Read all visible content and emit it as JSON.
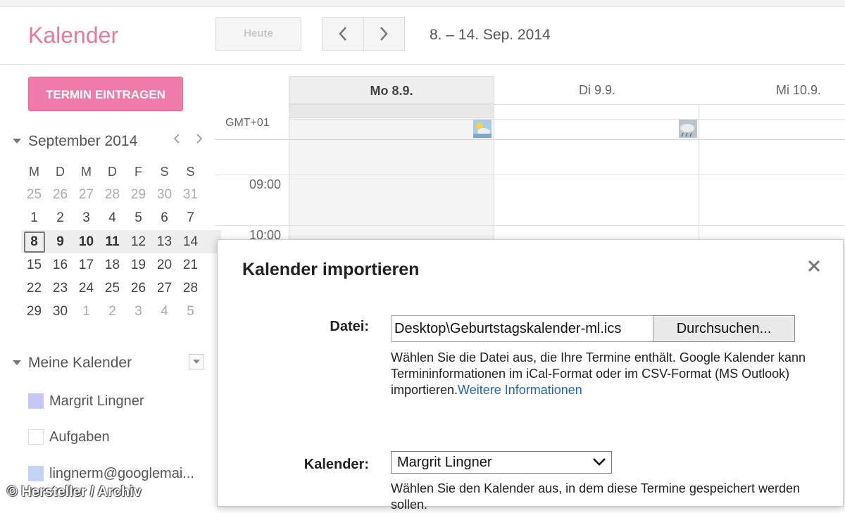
{
  "header": {
    "app_title": "Kalender",
    "today_label": "Heute",
    "date_range": "8. – 14. Sep. 2014"
  },
  "sidebar": {
    "create_label": "TERMIN EINTRAGEN",
    "mini_calendar": {
      "title": "September 2014",
      "weekdays": [
        "M",
        "D",
        "M",
        "D",
        "F",
        "S",
        "S"
      ],
      "weeks": [
        [
          "25",
          "26",
          "27",
          "28",
          "29",
          "30",
          "31"
        ],
        [
          "1",
          "2",
          "3",
          "4",
          "5",
          "6",
          "7"
        ],
        [
          "8",
          "9",
          "10",
          "11",
          "12",
          "13",
          "14"
        ],
        [
          "15",
          "16",
          "17",
          "18",
          "19",
          "20",
          "21"
        ],
        [
          "22",
          "23",
          "24",
          "25",
          "26",
          "27",
          "28"
        ],
        [
          "29",
          "30",
          "1",
          "2",
          "3",
          "4",
          "5"
        ]
      ],
      "prev_icon": "chevron-left-icon",
      "next_icon": "chevron-right-icon"
    },
    "my_calendars": {
      "title": "Meine Kalender",
      "items": [
        {
          "label": "Margrit Lingner",
          "color": "#c5c7f4"
        },
        {
          "label": "Aufgaben",
          "color": "#ffffff"
        },
        {
          "label": "lingnerm@googlemai...",
          "color": "#c3d4f2"
        }
      ]
    }
  },
  "grid": {
    "timezone": "GMT+01",
    "days": [
      "Mo 8.9.",
      "Di 9.9.",
      "Mi 10.9."
    ],
    "times": [
      "09:00",
      "10:00"
    ]
  },
  "dialog": {
    "title": "Kalender importieren",
    "close_icon": "close-icon",
    "file_label": "Datei:",
    "file_value": "Desktop\\Geburtstagskalender-ml.ics",
    "browse_label": "Durchsuchen...",
    "file_help": "Wählen Sie die Datei aus, die Ihre Termine enthält. Google Kalender kann Termininformationen im iCal-Format oder im CSV-Format (MS Outlook) importieren.",
    "file_help_link": "Weitere Informationen",
    "calendar_label": "Kalender:",
    "calendar_value": "Margrit Lingner",
    "calendar_help": "Wählen Sie den Kalender aus, in dem diese Termine gespeichert werden sollen."
  },
  "watermark": "© Hersteller / Archiv",
  "colors": {
    "brand": "#e8789f",
    "create_button": "#f07aa8",
    "link": "#1f66b4"
  }
}
